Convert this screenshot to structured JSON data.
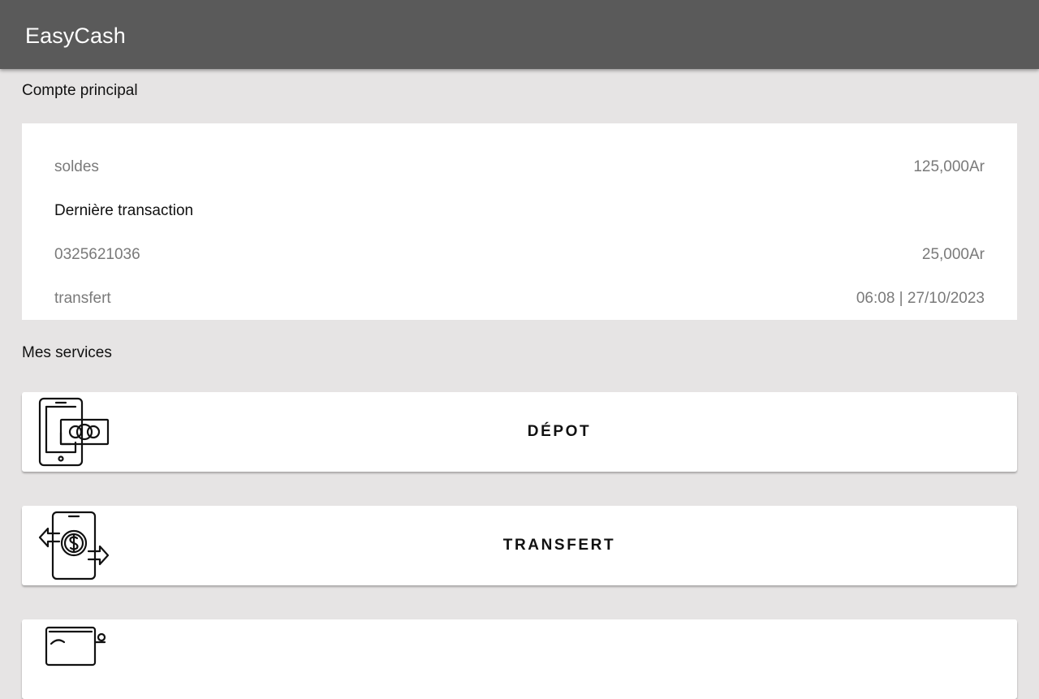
{
  "app": {
    "title": "EasyCash"
  },
  "account": {
    "section_title": "Compte principal",
    "balance_label": "soldes",
    "balance_value": "125,000Ar",
    "last_tx_heading": "Dernière transaction",
    "last_tx_number": "0325621036",
    "last_tx_amount": "25,000Ar",
    "last_tx_type": "transfert",
    "last_tx_datetime": "06:08 | 27/10/2023"
  },
  "services": {
    "section_title": "Mes services",
    "items": [
      {
        "label": "DÉPOT",
        "icon": "phone-cash-deposit-icon"
      },
      {
        "label": "TRANSFERT",
        "icon": "phone-money-transfer-icon"
      },
      {
        "label": "",
        "icon": "wallet-card-icon"
      }
    ]
  },
  "colors": {
    "appbar": "#5a5a5a",
    "background": "#e6e4e4",
    "card": "#ffffff",
    "muted_text": "#7a7a7a"
  }
}
